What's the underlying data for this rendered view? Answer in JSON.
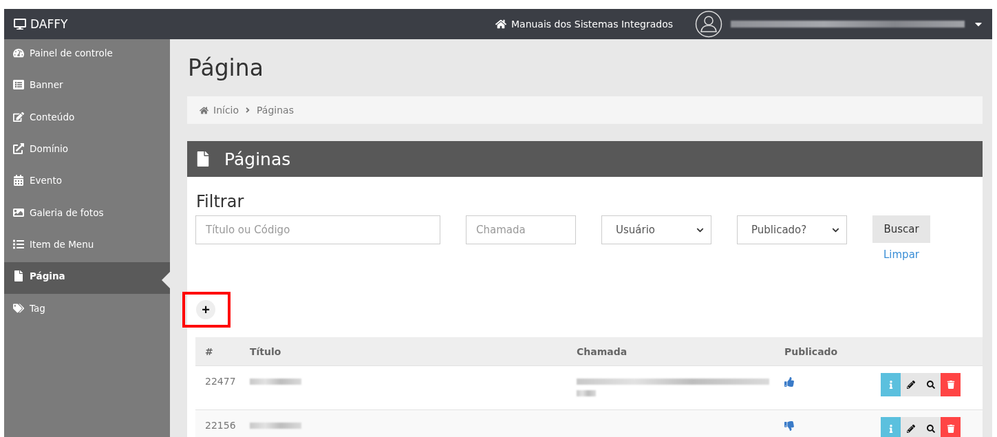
{
  "topbar": {
    "brand": "DAFFY",
    "manual_link": "Manuais dos Sistemas Integrados"
  },
  "sidebar": {
    "items": [
      {
        "label": "Painel de controle",
        "selected": false
      },
      {
        "label": "Banner",
        "selected": false
      },
      {
        "label": "Conteúdo",
        "selected": false
      },
      {
        "label": "Domínio",
        "selected": false
      },
      {
        "label": "Evento",
        "selected": false
      },
      {
        "label": "Galeria de fotos",
        "selected": false
      },
      {
        "label": "Item de Menu",
        "selected": false
      },
      {
        "label": "Página",
        "selected": true
      },
      {
        "label": "Tag",
        "selected": false
      }
    ]
  },
  "page_title": "Página",
  "breadcrumb": [
    "Início",
    "Páginas"
  ],
  "panel": {
    "title": "Páginas",
    "filter": {
      "heading": "Filtrar",
      "fields": [
        {
          "kind": "input",
          "placeholder": "Título ou Código"
        },
        {
          "kind": "input",
          "placeholder": "Chamada"
        },
        {
          "kind": "select",
          "value": "Usuário"
        },
        {
          "kind": "select",
          "value": "Publicado?"
        }
      ],
      "search_button": "Buscar",
      "clear_link": "Limpar"
    },
    "add_button": "+",
    "table": {
      "columns": [
        "#",
        "Título",
        "Chamada",
        "Publicado"
      ],
      "rows": [
        {
          "id": "22477",
          "published": true
        },
        {
          "id": "22156",
          "published": false
        }
      ]
    }
  }
}
